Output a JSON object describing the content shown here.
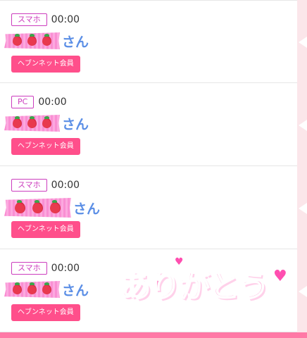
{
  "cards": [
    {
      "device": "スマホ",
      "time": "00:00",
      "suffix": "さん",
      "member": "ヘブンネット会員"
    },
    {
      "device": "PC",
      "time": "00:00",
      "suffix": "さん",
      "member": "ヘブンネット会員"
    },
    {
      "device": "スマホ",
      "time": "00:00",
      "suffix": "さん",
      "member": "ヘブンネット会員"
    },
    {
      "device": "スマホ",
      "time": "00:00",
      "suffix": "さん",
      "member": "ヘブンネット会員"
    }
  ],
  "sticker": {
    "text": "ありがとう",
    "heart": "♥"
  },
  "icons": {
    "berry": "strawberry-icon",
    "heart": "heart-icon"
  },
  "colors": {
    "device": "#cc3dbe",
    "member": "#ff4f8b",
    "name": "#5c8fe6",
    "accent": "#ff79a6"
  }
}
